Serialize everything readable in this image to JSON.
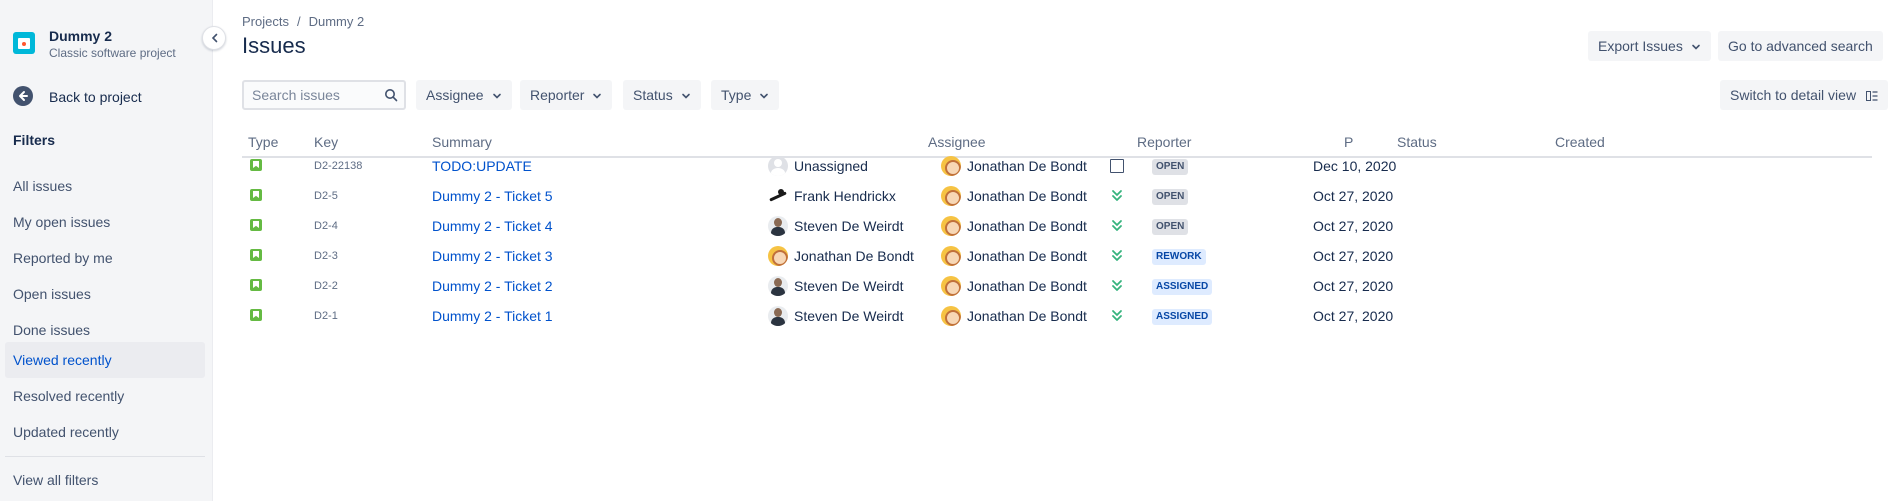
{
  "sidebar": {
    "project_name": "Dummy 2",
    "project_type": "Classic software project",
    "back_label": "Back to project",
    "filters_heading": "Filters",
    "items": [
      {
        "label": "All issues",
        "active": false
      },
      {
        "label": "My open issues",
        "active": false
      },
      {
        "label": "Reported by me",
        "active": false
      },
      {
        "label": "Open issues",
        "active": false
      },
      {
        "label": "Done issues",
        "active": false
      },
      {
        "label": "Viewed recently",
        "active": true
      },
      {
        "label": "Resolved recently",
        "active": false
      },
      {
        "label": "Updated recently",
        "active": false
      }
    ],
    "view_all_filters": "View all filters"
  },
  "header": {
    "breadcrumbs": [
      "Projects",
      "Dummy 2"
    ],
    "breadcrumb_separator": "/",
    "title": "Issues",
    "export_label": "Export Issues",
    "advanced_search_label": "Go to advanced search"
  },
  "toolbar": {
    "search_placeholder": "Search issues",
    "filters": [
      "Assignee",
      "Reporter",
      "Status",
      "Type"
    ],
    "detail_view_label": "Switch to detail view"
  },
  "table": {
    "columns": [
      "Type",
      "Key",
      "Summary",
      "Assignee",
      "Reporter",
      "P",
      "Status",
      "Created"
    ],
    "rows": [
      {
        "key": "D2-22138",
        "summary": "TODO:UPDATE",
        "assignee": "Unassigned",
        "assignee_avatar": "unassigned",
        "reporter": "Jonathan De Bondt",
        "priority": "none",
        "status": "OPEN",
        "status_style": "open",
        "created": "Dec 10, 2020"
      },
      {
        "key": "D2-5",
        "summary": "Dummy 2 - Ticket 5",
        "assignee": "Frank Hendrickx",
        "assignee_avatar": "frank",
        "reporter": "Jonathan De Bondt",
        "priority": "lowest",
        "status": "OPEN",
        "status_style": "open",
        "created": "Oct 27, 2020"
      },
      {
        "key": "D2-4",
        "summary": "Dummy 2 - Ticket 4",
        "assignee": "Steven De Weirdt",
        "assignee_avatar": "steven",
        "reporter": "Jonathan De Bondt",
        "priority": "lowest",
        "status": "OPEN",
        "status_style": "open",
        "created": "Oct 27, 2020"
      },
      {
        "key": "D2-3",
        "summary": "Dummy 2 - Ticket 3",
        "assignee": "Jonathan De Bondt",
        "assignee_avatar": "jonathan",
        "reporter": "Jonathan De Bondt",
        "priority": "lowest",
        "status": "REWORK",
        "status_style": "blue",
        "created": "Oct 27, 2020"
      },
      {
        "key": "D2-2",
        "summary": "Dummy 2 - Ticket 2",
        "assignee": "Steven De Weirdt",
        "assignee_avatar": "steven",
        "reporter": "Jonathan De Bondt",
        "priority": "lowest",
        "status": "ASSIGNED",
        "status_style": "blue",
        "created": "Oct 27, 2020"
      },
      {
        "key": "D2-1",
        "summary": "Dummy 2 - Ticket 1",
        "assignee": "Steven De Weirdt",
        "assignee_avatar": "steven",
        "reporter": "Jonathan De Bondt",
        "priority": "lowest",
        "status": "ASSIGNED",
        "status_style": "blue",
        "created": "Oct 27, 2020"
      }
    ]
  },
  "colors": {
    "link": "#0052cc",
    "project_icon": "#00b8d9",
    "story_icon": "#65ba43",
    "priority_lowest": "#36b37e"
  },
  "icons": {
    "project": "project-calendar-icon",
    "back": "arrow-left-icon",
    "search": "search-icon",
    "chevron": "chevron-down-icon",
    "detail_view": "detail-view-icon",
    "story": "story-icon",
    "priority_lowest": "priority-lowest-icon"
  }
}
